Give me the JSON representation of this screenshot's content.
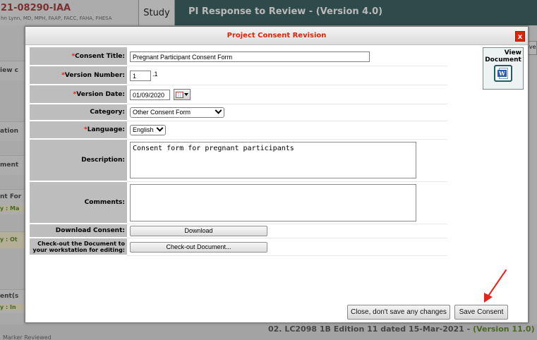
{
  "background": {
    "protocol_id": "21-08290-IAA",
    "protocol_pi": "hn Lynn, MD, MPH, FAAP, FACC, FAHA, FHESA",
    "study_tab": "Study",
    "page_title": "PI Response to Review - (Version 4.0)",
    "right_button_fragment": "ave",
    "left_fragments": [
      "iew c",
      "ation",
      "ment",
      "nt For",
      "y : Ma",
      "y : Ot",
      "ent(s",
      "y : In"
    ],
    "bottom_row_text": "02. LC2098 1B Edition 11 dated 15-Mar-2021 -",
    "bottom_row_version": "(Version 11.0)",
    "footer_fragment": "Marker Reviewed"
  },
  "modal": {
    "title": "Project Consent Revision",
    "close_label": "x",
    "fields": {
      "consent_title": {
        "label": "Consent Title:",
        "required": "*",
        "value": "Pregnant Participant Consent Form"
      },
      "version_number": {
        "label": "Version Number:",
        "required": "*",
        "value": "1",
        "suffix": ".1"
      },
      "version_date": {
        "label": "Version Date:",
        "required": "*",
        "value": "01/09/2020"
      },
      "category": {
        "label": "Category:",
        "value": "Other Consent Form"
      },
      "language": {
        "label": "Language:",
        "required": "* ",
        "value": "English"
      },
      "description": {
        "label": "Description:",
        "value": "Consent form for pregnant participants"
      },
      "comments": {
        "label": "Comments:",
        "value": ""
      },
      "download": {
        "label": "Download Consent:",
        "button": "Download"
      },
      "checkout": {
        "label_line1": "Check-out the Document to",
        "label_line2": "your workstation for editing:",
        "button": "Check-out Document..."
      }
    },
    "view_document": {
      "line1": "View",
      "line2": "Document",
      "icon": "word-document-icon"
    },
    "buttons": {
      "close": "Close, don't save any changes",
      "save": "Save Consent"
    }
  },
  "colors": {
    "header_text": "#d9250a",
    "required": "#e02020",
    "annotation_arrow": "#e8231b",
    "top_bar": "#1f4c4e"
  }
}
